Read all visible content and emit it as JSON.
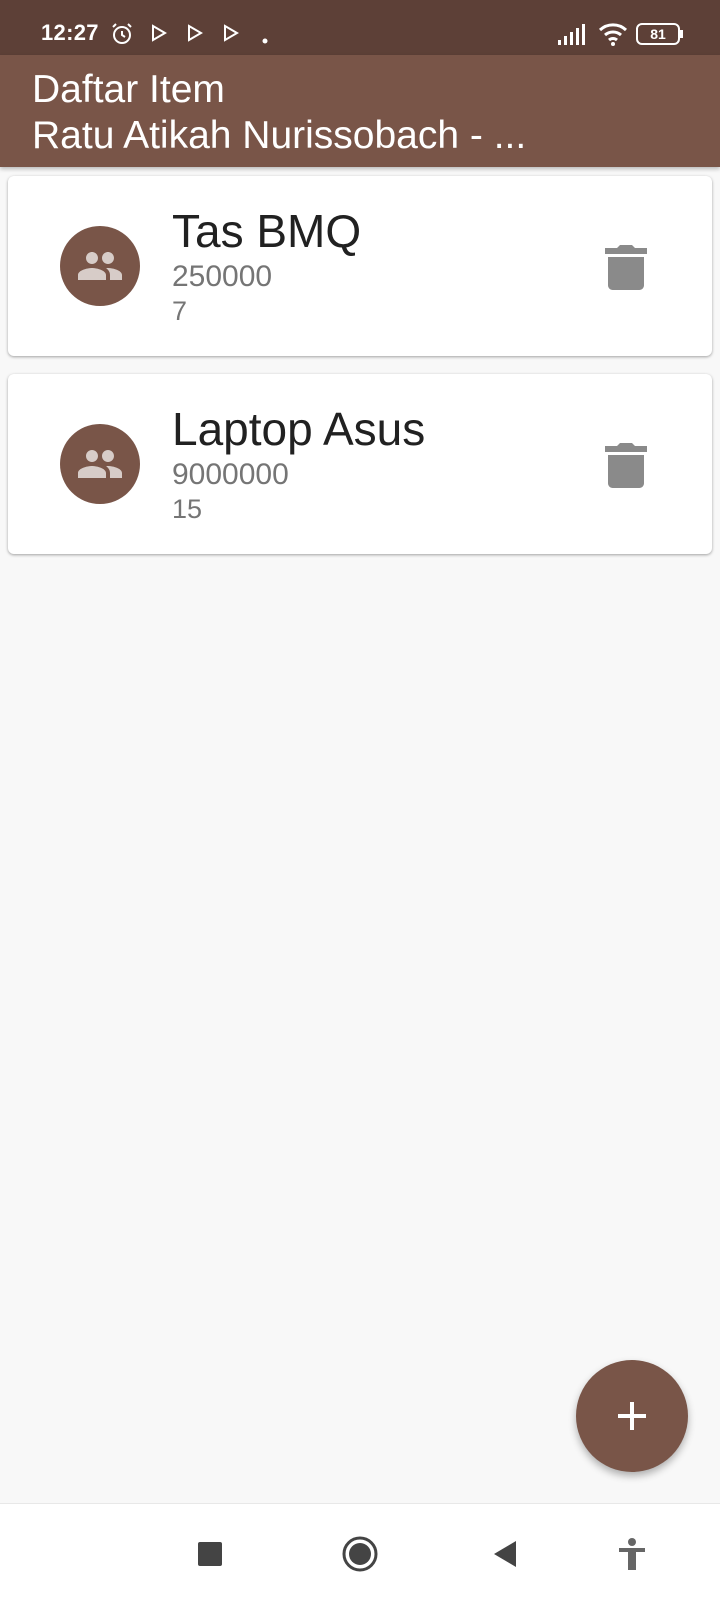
{
  "status_bar": {
    "time": "12:27",
    "battery": "81",
    "icons": [
      "alarm-icon",
      "play-store-icon",
      "play-store-icon",
      "play-store-icon",
      "dot-icon",
      "signal-icon",
      "wifi-icon",
      "battery-icon"
    ]
  },
  "app_bar": {
    "title": "Daftar Item",
    "subtitle": "Ratu Atikah Nurissobach - ..."
  },
  "items": [
    {
      "name": "Tas BMQ",
      "price": "250000",
      "qty": "7",
      "icon": "people-icon",
      "action_icon": "delete-icon"
    },
    {
      "name": "Laptop Asus",
      "price": "9000000",
      "qty": "15",
      "icon": "people-icon",
      "action_icon": "delete-icon"
    }
  ],
  "fab": {
    "icon": "add-icon"
  },
  "nav_bar": {
    "buttons": [
      "recents-icon",
      "home-icon",
      "back-icon",
      "accessibility-icon"
    ]
  },
  "colors": {
    "status_bar": "#5d4037",
    "app_bar": "#795548",
    "accent": "#795548",
    "background": "#f8f8f8"
  }
}
